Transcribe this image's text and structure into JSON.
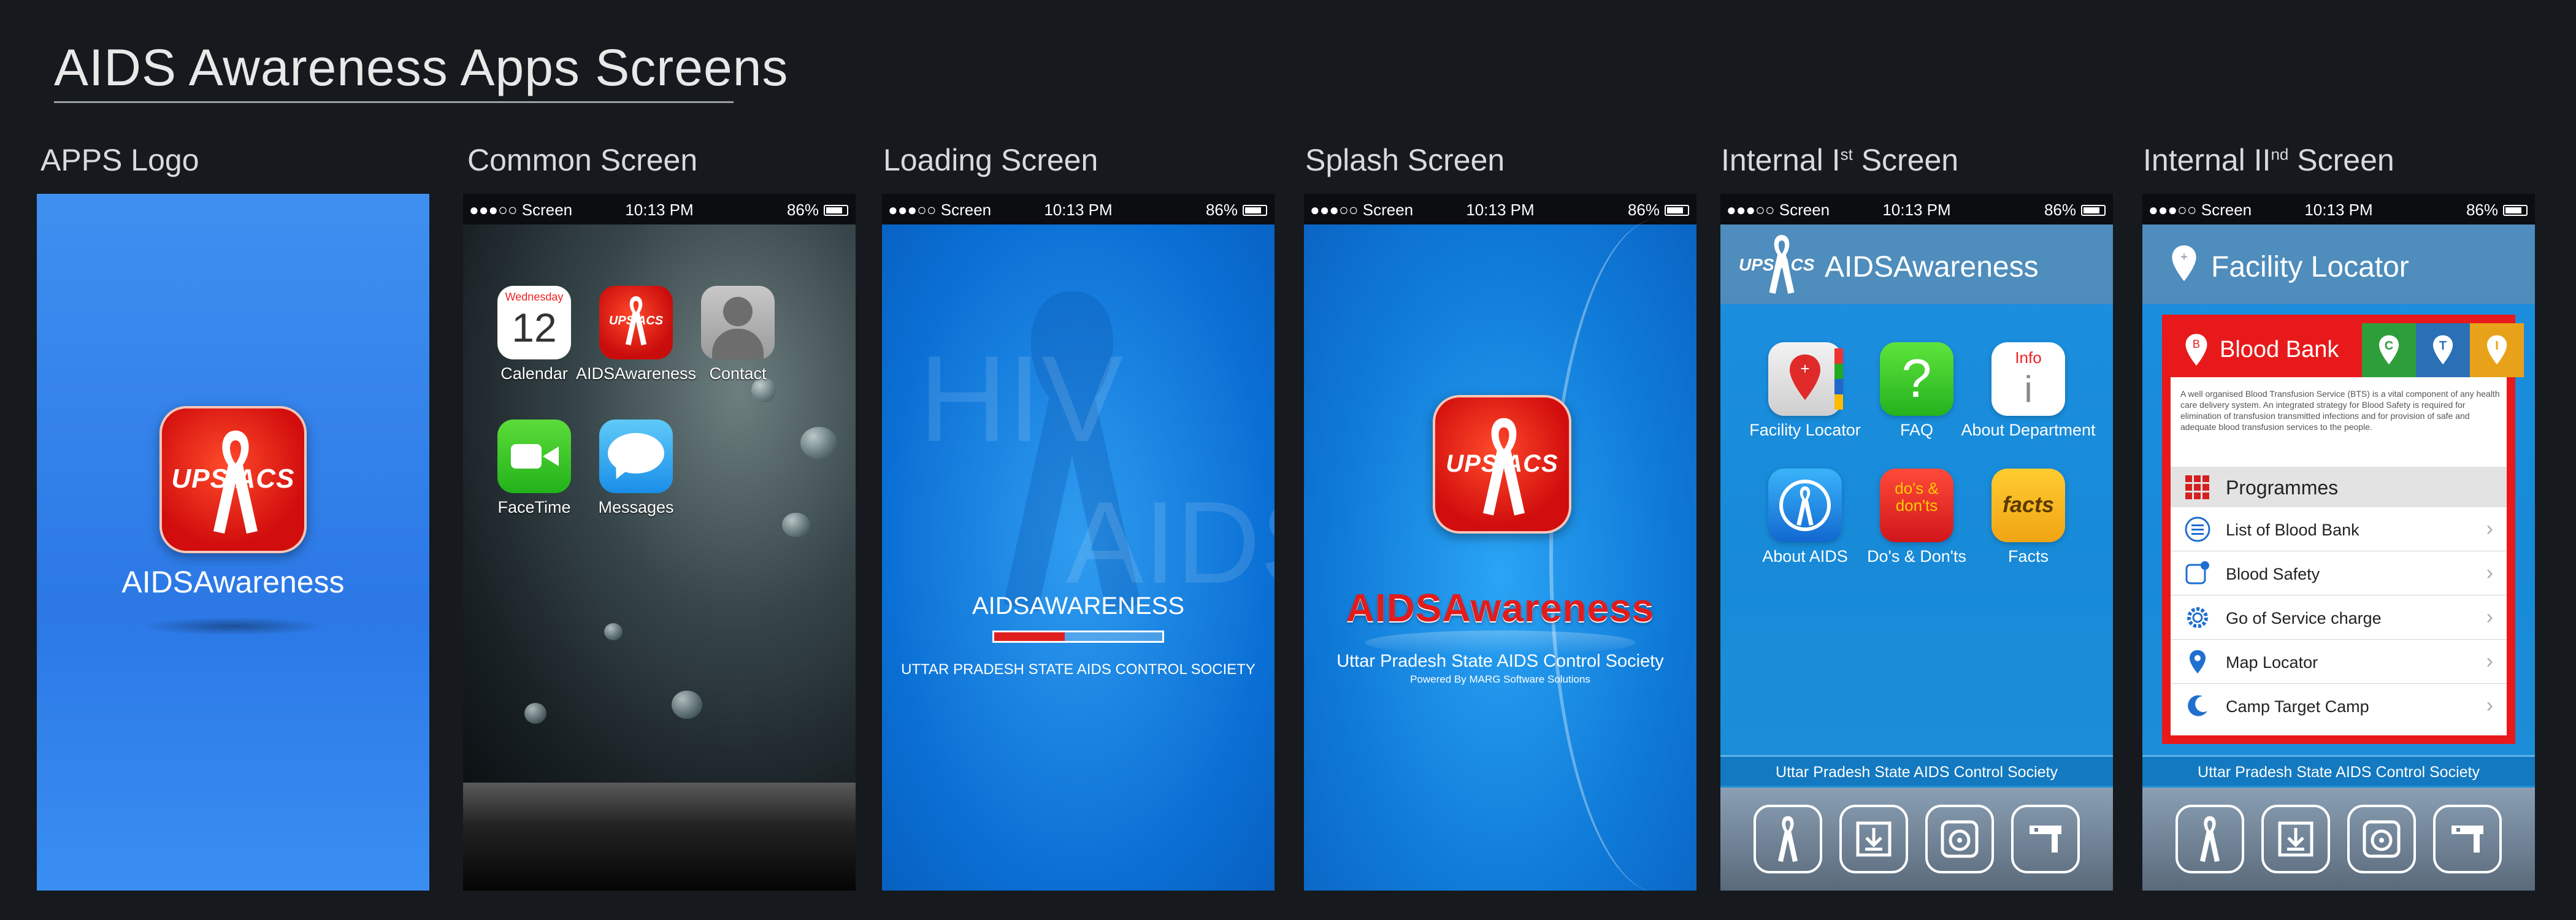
{
  "page": {
    "title": "AIDS Awareness Apps Screens"
  },
  "columns": {
    "apps_logo": "APPS Logo",
    "common": "Common Screen",
    "loading": "Loading Screen",
    "splash": "Splash Screen",
    "internal1_pre": "Internal I",
    "internal1_sup": "st",
    "internal1_post": " Screen",
    "internal2_pre": "Internal II",
    "internal2_sup": "nd",
    "internal2_post": " Screen"
  },
  "status_bar": {
    "carrier": "●●●○○ Screen",
    "time": "10:13 PM",
    "battery": "86%"
  },
  "logo": {
    "text": "UPS  ACS",
    "app_name": "AIDSAwareness"
  },
  "home_screen": {
    "calendar_day": "Wednesday",
    "calendar_date": "12",
    "apps": [
      "Calendar",
      "AIDSAwareness",
      "Contact",
      "FaceTime",
      "Messages"
    ]
  },
  "loading": {
    "bg_hiv": "HIV",
    "bg_aids": "AIDS",
    "brand": "AIDSAWARENESS",
    "progress": 0.42,
    "org": "UTTAR PRADESH STATE AIDS CONTROL SOCIETY"
  },
  "splash": {
    "brand": "AIDSAwareness",
    "org": "Uttar Pradesh State AIDS Control Society",
    "powered": "Powered By MARG Software Solutions"
  },
  "internal1": {
    "header_logo": "UPS  ACS",
    "header_title": "AIDSAwareness",
    "icons": [
      {
        "label": "Facility Locator"
      },
      {
        "label": "FAQ",
        "glyph": "?"
      },
      {
        "label": "About Department",
        "glyph_top": "Info",
        "glyph": "i"
      },
      {
        "label": "About AIDS"
      },
      {
        "label": "Do's & Don'ts",
        "glyph": "do's & don'ts"
      },
      {
        "label": "Facts",
        "glyph": "facts"
      }
    ],
    "footer": "Uttar Pradesh State AIDS Control Society"
  },
  "internal2": {
    "header_title": "Facility Locator",
    "bb_title": "Blood Bank",
    "tabs": [
      {
        "letter": "C",
        "color": "#2e9e3a"
      },
      {
        "letter": "T",
        "color": "#2b6fb5"
      },
      {
        "letter": "I",
        "color": "#e8a21a"
      }
    ],
    "description": "A well organised Blood Transfusion Service (BTS) is a vital component of any health care delivery system. An integrated strategy for Blood Safety is required for elimination of transfusion transmitted infections and for provision of safe and adequate blood transfusion services to the people.",
    "programmes": "Programmes",
    "menu": [
      "List of Blood Bank",
      "Blood Safety",
      "Go of Service charge",
      "Map Locator",
      "Camp Target Camp"
    ],
    "footer": "Uttar Pradesh State AIDS Control Society"
  },
  "colors": {
    "brand_red": "#e01e1e",
    "accent_blue": "#1a8ae0",
    "bg": "#16191d"
  }
}
